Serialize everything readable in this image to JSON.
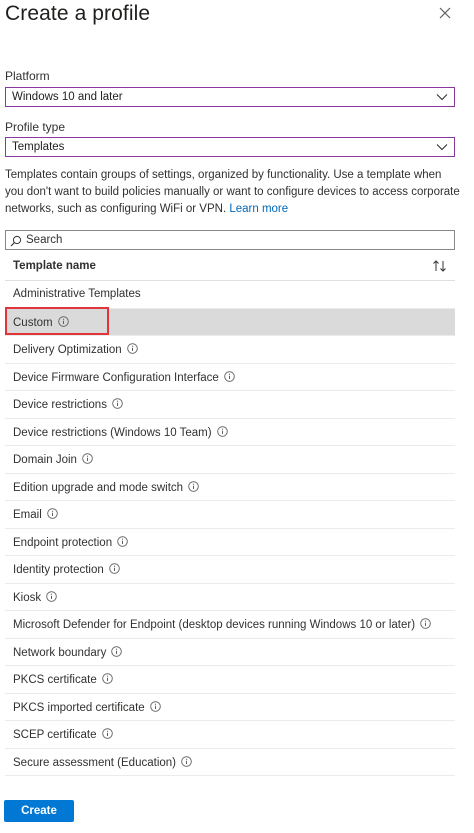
{
  "panel": {
    "title": "Create a profile",
    "close_icon": "close-icon"
  },
  "platform": {
    "label": "Platform",
    "value": "Windows 10 and later"
  },
  "profile_type": {
    "label": "Profile type",
    "value": "Templates"
  },
  "description": {
    "text": "Templates contain groups of settings, organized by functionality. Use a template when you don't want to build policies manually or want to configure devices to access corporate networks, such as configuring WiFi or VPN. ",
    "link": "Learn more"
  },
  "search": {
    "placeholder": "Search",
    "value": ""
  },
  "table": {
    "header": "Template name",
    "sort_icon": "sort-up-down-icon",
    "rows": [
      "Administrative Templates",
      "Custom",
      "Delivery Optimization",
      "Device Firmware Configuration Interface",
      "Device restrictions",
      "Device restrictions (Windows 10 Team)",
      "Domain Join",
      "Edition upgrade and mode switch",
      "Email",
      "Endpoint protection",
      "Identity protection",
      "Kiosk",
      "Microsoft Defender for Endpoint (desktop devices running Windows 10 or later)",
      "Network boundary",
      "PKCS certificate",
      "PKCS imported certificate",
      "SCEP certificate",
      "Secure assessment (Education)"
    ],
    "rows_with_info": [
      false,
      true,
      true,
      true,
      true,
      true,
      true,
      true,
      true,
      true,
      true,
      true,
      true,
      true,
      true,
      true,
      true,
      true
    ],
    "selected_row": "Custom"
  },
  "actions": {
    "create_label": "Create"
  },
  "colors": {
    "accent": "#0078d4",
    "select_border": "#8a38a0",
    "highlight": "#e0353a",
    "selected_row": "#dadada",
    "link": "#0067b8"
  }
}
